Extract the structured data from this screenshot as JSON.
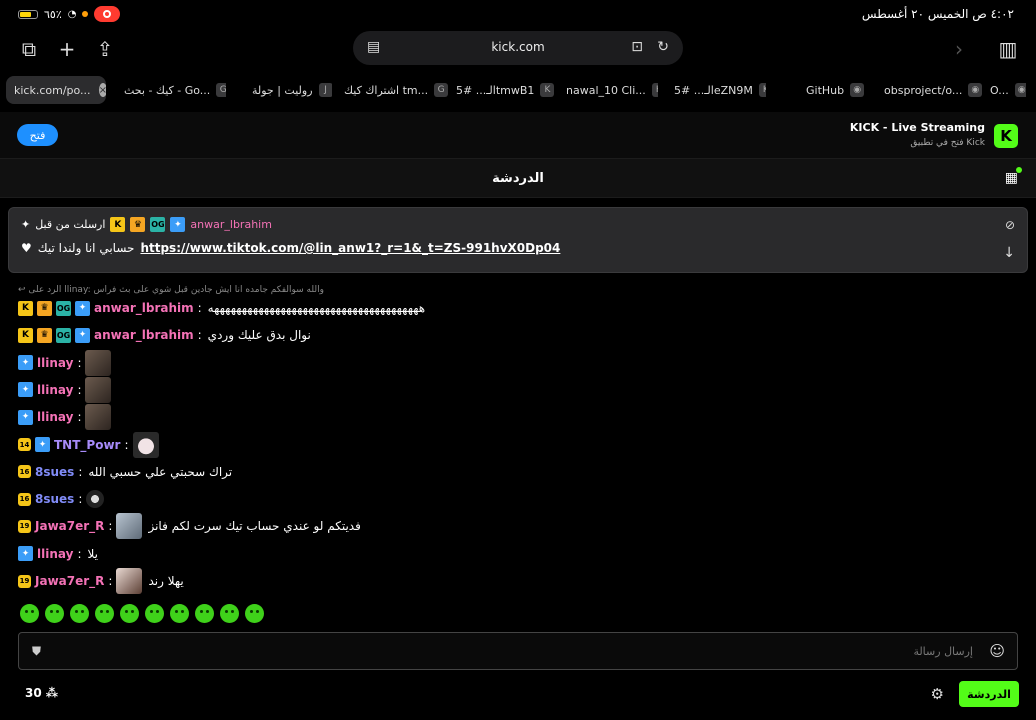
{
  "status": {
    "battery": "٦٥٪",
    "datetime": "٤:٠٢ ص  الخميس ٢٠ أغسطس",
    "battery_level": 0.65
  },
  "browser": {
    "url": "kick.com",
    "tabs": [
      {
        "label": "kick.com/po...",
        "active": true
      },
      {
        "label": "كيك - بحث - Go...",
        "fav": "G"
      },
      {
        "label": "روليت | جولة",
        "fav": "J"
      },
      {
        "label": "اشتراك كيك tm...",
        "fav": "G"
      },
      {
        "label": "الـ... #5tmwB1",
        "fav": "K"
      },
      {
        "label": "nawal_10 Cli...",
        "fav": "K"
      },
      {
        "label": "الـ... #5eZN9M",
        "fav": "K"
      },
      {
        "label": "GitHub",
        "fav": "◉"
      },
      {
        "label": "obsproject/o...",
        "fav": "◉"
      },
      {
        "label": "O...",
        "fav": "◉"
      }
    ]
  },
  "banner": {
    "open_label": "فتح",
    "app_title": "KICK - Live Streaming",
    "app_subtitle": "فتح في تطبيق Kick"
  },
  "chat": {
    "title": "الدردشة",
    "pinned": {
      "sender": "anwar_lbrahim",
      "meta": "ارسلت من قبل",
      "link": "https://www.tiktok.com/@lin_anw1?_r=1&_t=ZS-991hvX0Dp04",
      "text": "حسابي انا ولندا تيك"
    },
    "reply_hint": "الرد على llinay: والله سوالفكم جامده انا ايش جادين قبل شوي على بث فراس",
    "messages": [
      {
        "user": "anwar_lbrahim",
        "color": "#f472b6",
        "text": "ههههههههههههههههههههههههههههههههههههههه",
        "badges": [
          "k",
          "crown",
          "og",
          "vip"
        ]
      },
      {
        "user": "anwar_lbrahim",
        "color": "#f472b6",
        "text": "نوال بدق عليك وردي",
        "badges": [
          "k",
          "crown",
          "og",
          "vip"
        ]
      },
      {
        "user": "llinay",
        "color": "#f472b6",
        "text": "",
        "badges": [
          "vip"
        ],
        "emote": "emote"
      },
      {
        "user": "llinay",
        "color": "#f472b6",
        "text": "",
        "badges": [
          "vip"
        ],
        "emote": "emote"
      },
      {
        "user": "llinay",
        "color": "#f472b6",
        "text": "",
        "badges": [
          "vip"
        ],
        "emote": "emote"
      },
      {
        "user": "TNT_Powr",
        "color": "#a78bfa",
        "text": "",
        "badges": [
          "sub",
          "vip"
        ],
        "emote": "cat",
        "sub": "14"
      },
      {
        "user": "8sues",
        "color": "#818cf8",
        "text": "تراك سحبتي علي حسبي الله",
        "badges": [
          "sub"
        ],
        "sub": "16"
      },
      {
        "user": "8sues",
        "color": "#818cf8",
        "text": "",
        "badges": [
          "sub"
        ],
        "emote": "small",
        "sub": "16"
      },
      {
        "user": "Jawa7er_R",
        "color": "#f472b6",
        "text": "فديتكم لو عندي حساب تيك سرت لكم فانز",
        "badges": [
          "sub"
        ],
        "emote": "pic",
        "sub": "19"
      },
      {
        "user": "llinay",
        "color": "#f472b6",
        "text": "يلا",
        "badges": [
          "vip"
        ]
      },
      {
        "user": "Jawa7er_R",
        "color": "#f472b6",
        "text": "يهلا رند",
        "badges": [
          "sub"
        ],
        "emote": "pic2",
        "sub": "19"
      }
    ],
    "input_placeholder": "إرسال رسالة",
    "viewer_count": "30",
    "chat_button": "الدردشة"
  }
}
